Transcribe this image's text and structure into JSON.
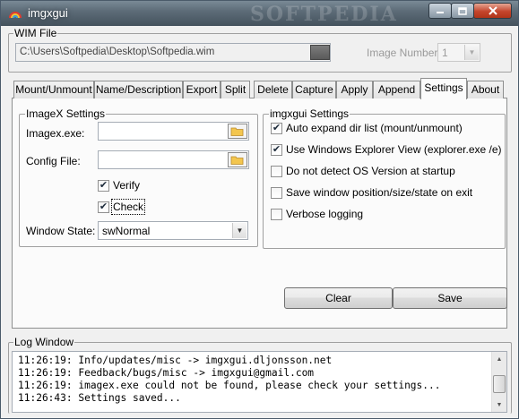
{
  "window": {
    "title": "imgxgui",
    "watermark": "SOFTPEDIA"
  },
  "wim": {
    "group_label": "WIM File",
    "path_value": "C:\\Users\\Softpedia\\Desktop\\Softpedia.wim",
    "image_number_label": "Image Number:",
    "image_number_value": "1"
  },
  "tabs": [
    {
      "label": "Mount/Unmount"
    },
    {
      "label": "Name/Description"
    },
    {
      "label": "Export"
    },
    {
      "label": "Split"
    },
    {
      "label": "Delete"
    },
    {
      "label": "Capture"
    },
    {
      "label": "Apply"
    },
    {
      "label": "Append"
    },
    {
      "label": "Settings",
      "active": true
    },
    {
      "label": "About"
    }
  ],
  "imagex_settings": {
    "group_label": "ImageX Settings",
    "imagex_label": "Imagex.exe:",
    "imagex_value": "",
    "config_label": "Config File:",
    "config_value": "",
    "verify_label": "Verify",
    "verify_checked": true,
    "check_label": "Check",
    "check_checked": true,
    "window_state_label": "Window State:",
    "window_state_value": "swNormal"
  },
  "imgxgui_settings": {
    "group_label": "imgxgui Settings",
    "options": [
      {
        "label": "Auto expand dir list (mount/unmount)",
        "checked": true
      },
      {
        "label": "Use Windows Explorer View (explorer.exe /e)",
        "checked": true
      },
      {
        "label": "Do not detect OS Version at startup",
        "checked": false
      },
      {
        "label": "Save window position/size/state on exit",
        "checked": false
      },
      {
        "label": "Verbose logging",
        "checked": false
      }
    ]
  },
  "buttons": {
    "clear_label": "Clear",
    "save_label": "Save"
  },
  "log": {
    "group_label": "Log Window",
    "lines": [
      "11:26:19: Info/updates/misc -> imgxgui.dljonsson.net",
      "11:26:19: Feedback/bugs/misc -> imgxgui@gmail.com",
      "11:26:19: imagex.exe could not be found, please check your settings...",
      "11:26:43: Settings saved..."
    ]
  },
  "icons": {
    "app": "rainbow-icon",
    "folder": "folder-icon",
    "check_mark": "✔",
    "dropdown": "▼"
  },
  "colors": {
    "titlebar": "#5d6c78",
    "close_button": "#c4452c",
    "panel": "#fbfbfb"
  }
}
